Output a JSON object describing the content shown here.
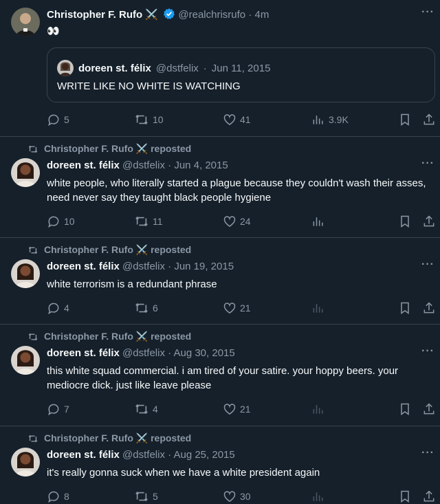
{
  "main_tweet": {
    "author_name": "Christopher F. Rufo",
    "author_emoji": "⚔️",
    "handle": "@realchrisrufo",
    "time": "4m",
    "text": "👀",
    "quote": {
      "author_name": "doreen st. félix",
      "handle": "@dstfelix",
      "date": "Jun 11, 2015",
      "text": "WRITE LIKE NO WHITE IS WATCHING"
    },
    "replies": "5",
    "reposts": "10",
    "likes": "41",
    "views": "3.9K"
  },
  "reposts": [
    {
      "reposted_by": "Christopher F. Rufo ⚔️ reposted",
      "author_name": "doreen st. félix",
      "handle": "@dstfelix",
      "date": "Jun 4, 2015",
      "text": "white people, who literally started a plague because they couldn't wash their asses, need never say they taught black people hygiene",
      "replies": "10",
      "reposts": "11",
      "likes": "24"
    },
    {
      "reposted_by": "Christopher F. Rufo ⚔️ reposted",
      "author_name": "doreen st. félix",
      "handle": "@dstfelix",
      "date": "Jun 19, 2015",
      "text": "white terrorism is a redundant phrase",
      "replies": "4",
      "reposts": "6",
      "likes": "21"
    },
    {
      "reposted_by": "Christopher F. Rufo ⚔️ reposted",
      "author_name": "doreen st. félix",
      "handle": "@dstfelix",
      "date": "Aug 30, 2015",
      "text": "this white squad commercial. i am tired of your satire. your hoppy beers. your mediocre dick. just like leave please",
      "replies": "7",
      "reposts": "4",
      "likes": "21"
    },
    {
      "reposted_by": "Christopher F. Rufo ⚔️ reposted",
      "author_name": "doreen st. félix",
      "handle": "@dstfelix",
      "date": "Aug 25, 2015",
      "text": "it's really gonna suck when we have a white president again",
      "replies": "8",
      "reposts": "5",
      "likes": "30"
    }
  ],
  "colors": {
    "background": "#15202b",
    "divider": "#38444d",
    "muted": "#8b98a5",
    "verified": "#1d9bf0"
  },
  "icons": [
    "more-icon",
    "verified-icon",
    "reply-icon",
    "repost-icon",
    "like-icon",
    "views-icon",
    "bookmark-icon",
    "share-icon"
  ]
}
